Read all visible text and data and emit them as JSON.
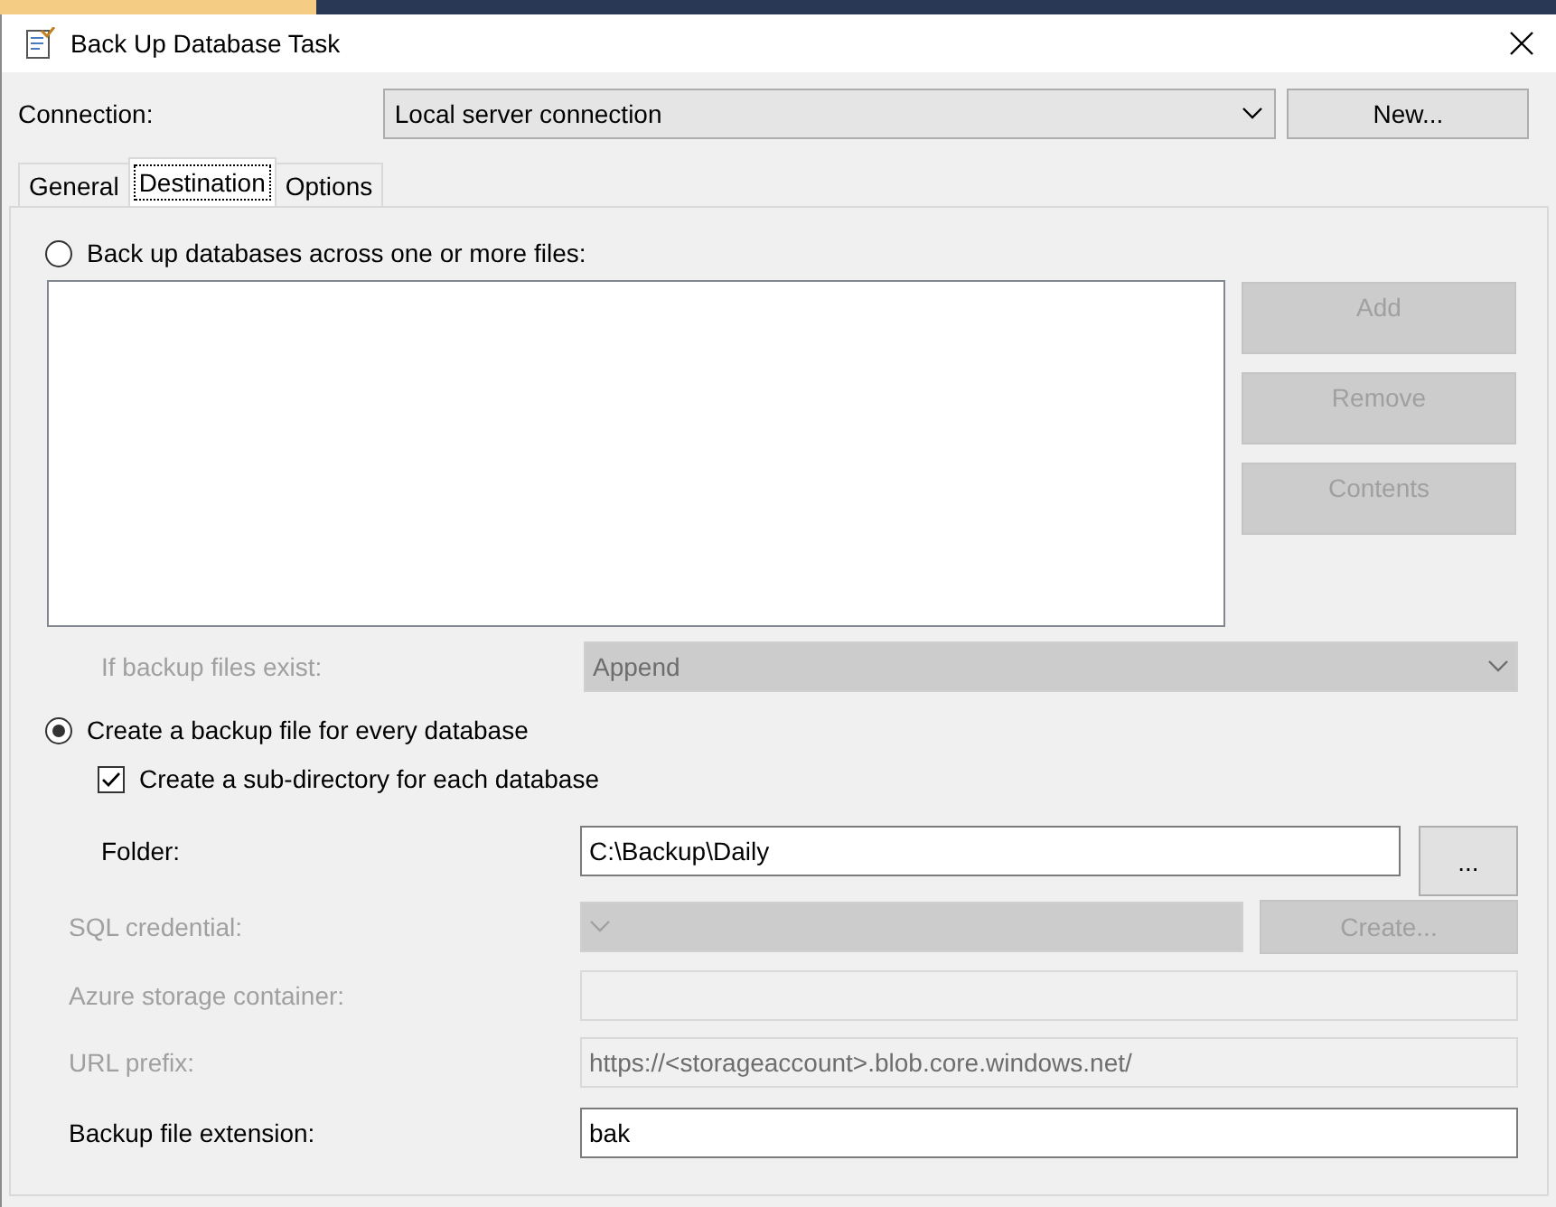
{
  "window": {
    "title": "Back Up Database Task"
  },
  "connection": {
    "label": "Connection:",
    "value": "Local server connection",
    "new_button": "New..."
  },
  "tabs": [
    {
      "label": "General",
      "selected": false
    },
    {
      "label": "Destination",
      "selected": true
    },
    {
      "label": "Options",
      "selected": false
    }
  ],
  "across_files_option": {
    "label": "Back up databases across one or more files:",
    "selected": false
  },
  "file_buttons": [
    {
      "label": "Add",
      "disabled": true
    },
    {
      "label": "Remove",
      "disabled": true
    },
    {
      "label": "Contents",
      "disabled": true
    }
  ],
  "if_exists": {
    "label": "If backup files exist:",
    "value": "Append",
    "disabled": true
  },
  "per_database_option": {
    "label": "Create a backup file for every database",
    "selected": true
  },
  "subdirectory": {
    "label": "Create a sub-directory for each database",
    "checked": true
  },
  "fields": [
    {
      "kind": "text",
      "label": "Folder:",
      "value": "C:\\Backup\\Daily",
      "button": "...",
      "disabled": false
    },
    {
      "kind": "dropdown",
      "label": "SQL credential:",
      "button": "Create...",
      "disabled": true
    },
    {
      "kind": "text",
      "label": "Azure storage container:",
      "disabled": true
    },
    {
      "kind": "text",
      "label": "URL prefix:",
      "value": "https://<storageaccount>.blob.core.windows.net/",
      "disabled": true
    },
    {
      "kind": "text",
      "label": "Backup file extension:",
      "value": "bak",
      "disabled": false
    }
  ]
}
